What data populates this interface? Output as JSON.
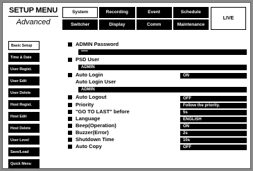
{
  "header": {
    "menu_title": "SETUP MENU",
    "menu_subtitle": "Advanced",
    "tabs": [
      {
        "label": "System",
        "active": true
      },
      {
        "label": "Recording",
        "active": false
      },
      {
        "label": "Event",
        "active": false
      },
      {
        "label": "Schedule",
        "active": false
      },
      {
        "label": "Switcher",
        "active": false
      },
      {
        "label": "Display",
        "active": false
      },
      {
        "label": "Comm",
        "active": false
      },
      {
        "label": "Maintenance",
        "active": false
      }
    ],
    "live_label": "LIVE"
  },
  "sidebar": {
    "items": [
      {
        "label": "Basic Setup",
        "active": true
      },
      {
        "label": "Time & Date",
        "active": false
      },
      {
        "label": "User Regist.",
        "active": false
      },
      {
        "label": "User Edit",
        "active": false
      },
      {
        "label": "User Delete",
        "active": false
      },
      {
        "label": "Host Regist.",
        "active": false
      },
      {
        "label": "Host Edit",
        "active": false
      },
      {
        "label": "Host Delete",
        "active": false
      },
      {
        "label": "User Level",
        "active": false
      },
      {
        "label": "Save/Load",
        "active": false
      },
      {
        "label": "Quick Menu",
        "active": false
      }
    ]
  },
  "settings": {
    "admin_password": {
      "label": "ADMIN Password",
      "value": "*****"
    },
    "psd_user": {
      "label": "PSD User",
      "value": "ADMIN"
    },
    "auto_login": {
      "label": "Auto Login",
      "value": "ON"
    },
    "auto_login_user": {
      "label": "Auto Login User",
      "value": "ADMIN"
    },
    "auto_logout": {
      "label": "Auto Logout",
      "value": "OFF"
    },
    "priority": {
      "label": "Priority",
      "value": "Follow the priority."
    },
    "goto_last": {
      "label": "\"GO TO LAST\" before",
      "value": "5s"
    },
    "language": {
      "label": "Language",
      "value": "ENGLISH"
    },
    "beep": {
      "label": "Beep(Operation)",
      "value": "ON"
    },
    "buzzer": {
      "label": "Buzzer(Error)",
      "value": "2s"
    },
    "shutdown_time": {
      "label": "Shutdown Time",
      "value": "10s"
    },
    "auto_copy": {
      "label": "Auto Copy",
      "value": "OFF"
    }
  }
}
